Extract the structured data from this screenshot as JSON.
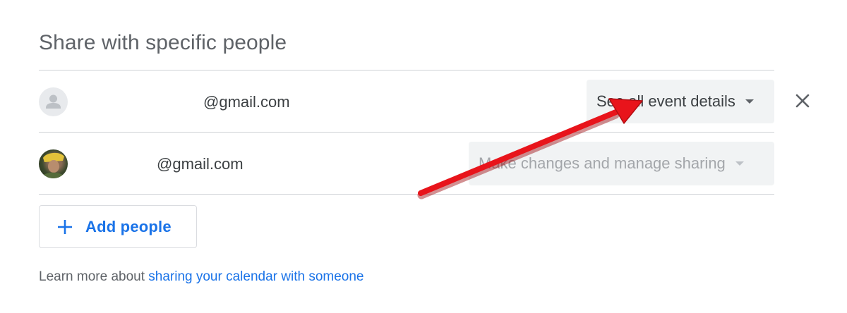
{
  "section": {
    "title": "Share with specific people"
  },
  "people": [
    {
      "email": "@gmail.com",
      "permission": "See all event details",
      "permission_enabled": true,
      "avatar": "person-placeholder-icon"
    },
    {
      "email": "@gmail.com",
      "permission": "Make changes and manage sharing",
      "permission_enabled": false,
      "avatar": "profile-photo"
    }
  ],
  "remove": {
    "icon": "close-icon"
  },
  "add_people": {
    "icon": "plus-icon",
    "label": "Add people"
  },
  "footer": {
    "prefix": "Learn more about ",
    "link": "sharing your calendar with someone"
  },
  "annotation": {
    "type": "red-arrow",
    "color": "#e8141b"
  },
  "colors": {
    "accent": "#1a73e8",
    "dropdown_bg": "#f1f3f4",
    "text": "#3c4043",
    "muted": "#5f6368"
  }
}
